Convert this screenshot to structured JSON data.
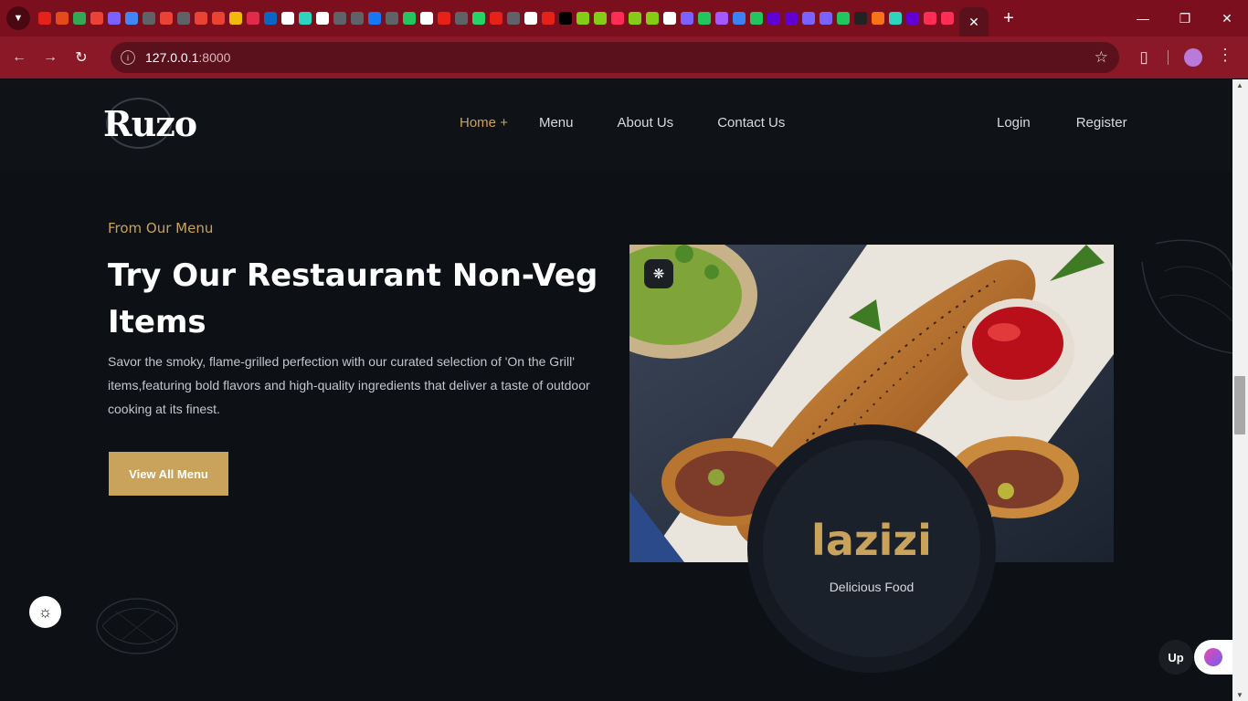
{
  "browser": {
    "url_host": "127.0.0.1",
    "url_port": ":8000",
    "new_tab_glyph": "+",
    "icons": {
      "tab_search": "chevron-down-icon",
      "close_tab": "close-icon",
      "back": "arrow-left-icon",
      "forward": "arrow-right-icon",
      "reload": "reload-icon",
      "site_info": "info-icon",
      "bookmark": "star-icon",
      "extensions": "puzzle-icon",
      "menu": "kebab-icon",
      "minimize": "minimize-icon",
      "restore": "restore-icon",
      "close_window": "close-icon"
    },
    "pinned_tab_colors": [
      "#e62117",
      "#e64a19",
      "#34a853",
      "#ea4335",
      "#7b61ff",
      "#4285f4",
      "#5f6368",
      "#ea4335",
      "#5f6368",
      "#ea4335",
      "#ea4335",
      "#f0b90b",
      "#e02b4a",
      "#0a66c2",
      "#ffffff",
      "#2dd4bf",
      "#ffffff",
      "#5f6368",
      "#5f6368",
      "#1877f2",
      "#5f6368",
      "#22c55e",
      "#ffffff",
      "#e62117",
      "#5f6368",
      "#25d366",
      "#e62117",
      "#5f6368",
      "#ffffff",
      "#e62117",
      "#000000",
      "#84cc16",
      "#84cc16",
      "#ff2d55",
      "#84cc16",
      "#84cc16",
      "#ffffff",
      "#7b61ff",
      "#22c55e",
      "#a259ff",
      "#3b82f6",
      "#22c55e",
      "#6001d2",
      "#6001d2",
      "#7b61ff",
      "#7b61ff",
      "#22c55e",
      "#222222",
      "#f97316",
      "#2dd4bf",
      "#6001d2",
      "#ff2d55",
      "#ff2d55"
    ],
    "accent": "#8b1826"
  },
  "site": {
    "logo": "Ruzo",
    "nav": [
      {
        "label": "Home",
        "suffix": "+",
        "active": true
      },
      {
        "label": "Menu"
      },
      {
        "label": "About Us"
      },
      {
        "label": "Contact Us"
      }
    ],
    "auth": {
      "login": "Login",
      "register": "Register"
    },
    "colors": {
      "gold": "#c9a35b",
      "background": "#0d1014"
    }
  },
  "hero": {
    "eyebrow": "From Our Menu",
    "headline": "Try Our Restaurant Non-Veg Items",
    "description": "Savor the smoky, flame-grilled perfection with our curated selection of 'On the Grill' items,featuring bold flavors and high-quality ingredients that deliver a taste of outdoor cooking at its finest.",
    "cta": "View All Menu",
    "brand_name": "lazizi",
    "brand_tagline": "Delicious Food"
  },
  "widgets": {
    "up_label": "Up",
    "theme_icon": "sun-icon",
    "ai_icon": "brain-icon"
  }
}
